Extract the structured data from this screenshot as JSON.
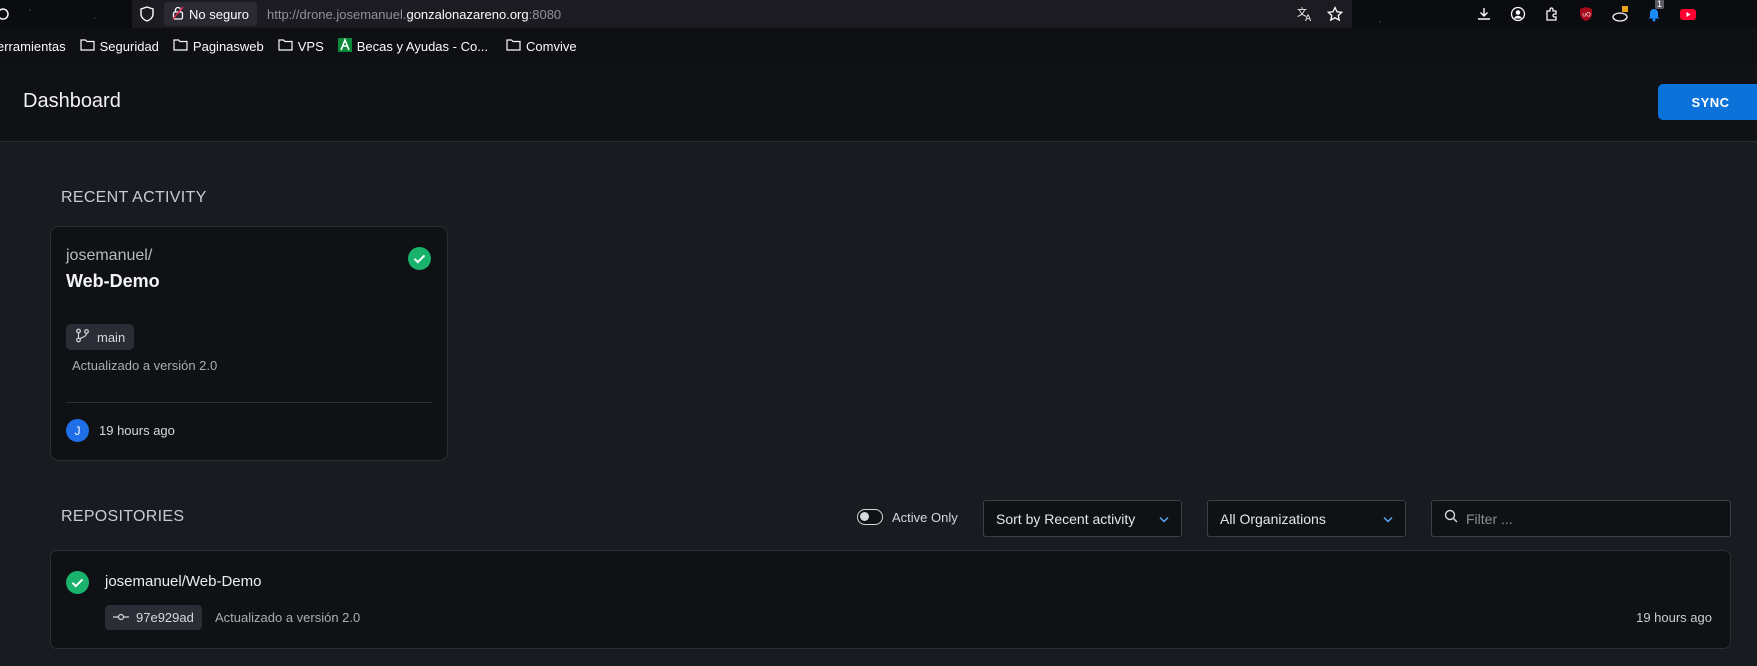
{
  "browser": {
    "security_label": "No seguro",
    "url_scheme": "http://drone.josemanuel.",
    "url_host": "gonzalonazareno.org",
    "url_port": ":8080",
    "notif_count": "1"
  },
  "bookmarks": [
    {
      "label": "erramientas",
      "icon": "folder-icon"
    },
    {
      "label": "Seguridad",
      "icon": "folder-icon"
    },
    {
      "label": "Paginasweb",
      "icon": "folder-icon"
    },
    {
      "label": "VPS",
      "icon": "folder-icon"
    },
    {
      "label": "Becas y Ayudas - Co...",
      "icon": "site-logo-icon"
    },
    {
      "label": "Comvive",
      "icon": "folder-icon"
    }
  ],
  "header": {
    "title": "Dashboard",
    "sync_label": "SYNC"
  },
  "recent": {
    "section_label": "RECENT ACTIVITY",
    "card": {
      "namespace": "josemanuel/",
      "repo": "Web-Demo",
      "branch": "main",
      "message": "Actualizado a versión 2.0",
      "avatar_initial": "J",
      "time": "19 hours ago"
    }
  },
  "repositories": {
    "section_label": "REPOSITORIES",
    "active_only_label": "Active Only",
    "sort_value": "Sort by Recent activity",
    "org_value": "All Organizations",
    "filter_placeholder": "Filter ...",
    "items": [
      {
        "name": "josemanuel/Web-Demo",
        "commit": "97e929ad",
        "message": "Actualizado a versión 2.0",
        "time": "19 hours ago"
      }
    ]
  },
  "colors": {
    "accent": "#0b72d9",
    "success": "#19b36b",
    "background": "#181b20",
    "panel": "#0f1114"
  }
}
